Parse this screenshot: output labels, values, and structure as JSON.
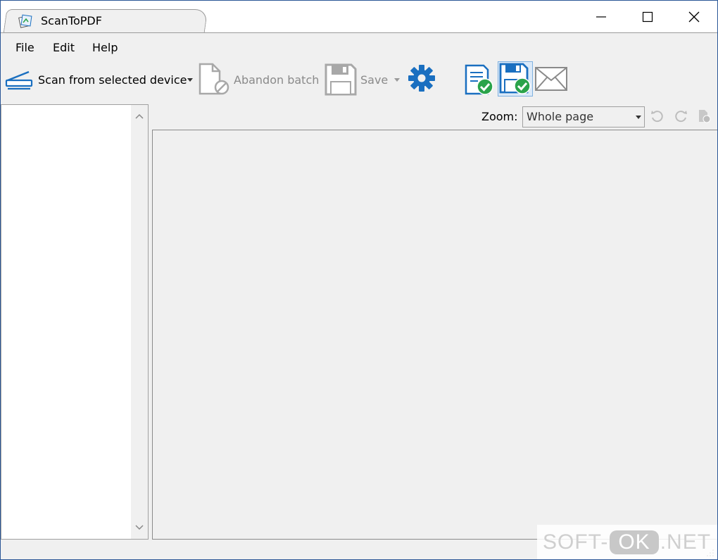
{
  "window": {
    "title": "ScanToPDF",
    "controls": {
      "minimize": "minimize",
      "maximize": "maximize",
      "close": "close"
    }
  },
  "menu": {
    "items": [
      {
        "label": "File"
      },
      {
        "label": "Edit"
      },
      {
        "label": "Help"
      }
    ]
  },
  "toolbar": {
    "scan_label": "Scan from selected device",
    "abandon_label": "Abandon batch",
    "save_label": "Save",
    "icons": [
      "scanner-icon",
      "abandon-document-icon",
      "floppy-save-icon",
      "gear-icon",
      "document-check-icon",
      "floppy-check-icon",
      "envelope-icon"
    ]
  },
  "zoom": {
    "label": "Zoom:",
    "value": "Whole page"
  },
  "colors": {
    "accent_blue": "#1a6fc0",
    "check_green": "#2aa34a",
    "disabled_gray": "#8a8a8a"
  },
  "watermark": {
    "part1": "SOFT-",
    "part2": "OK",
    "part3": ".NET"
  }
}
